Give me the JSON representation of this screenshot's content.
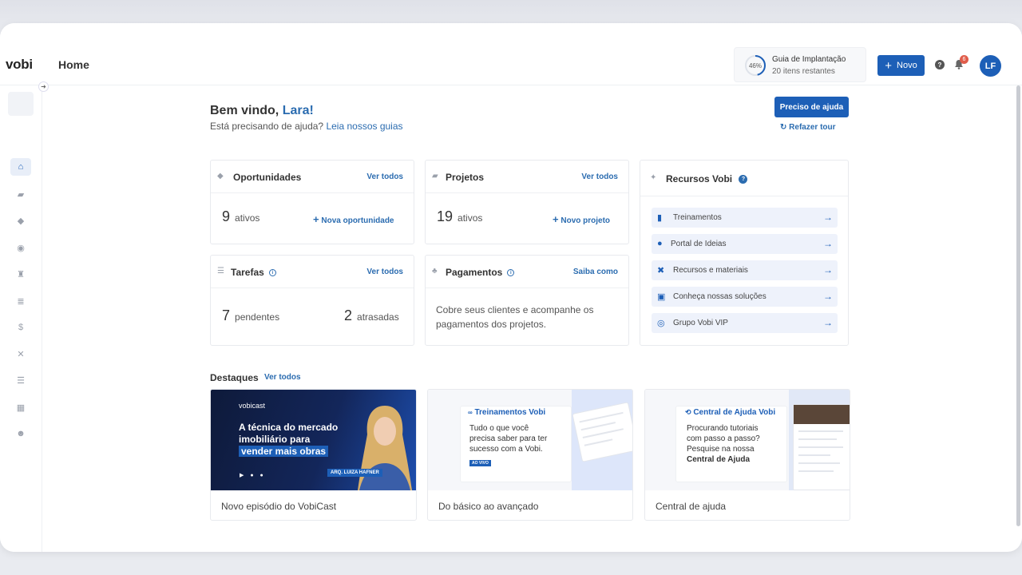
{
  "app": {
    "logo": "vobi",
    "page_title": "Home"
  },
  "guide": {
    "percent": "46%",
    "percent_value": 46,
    "title": "Guia de Implantação",
    "subtitle": "20 itens restantes"
  },
  "header": {
    "new_button": "Novo",
    "notifications_count": "6",
    "avatar_initials": "LF"
  },
  "welcome": {
    "greeting": "Bem vindo,",
    "name": "Lara!",
    "sub_text": "Está precisando de ajuda?",
    "sub_link": "Leia nossos guias",
    "help_button": "Preciso de ajuda",
    "redo_tour": "Refazer tour"
  },
  "cards": {
    "opportunities": {
      "title": "Oportunidades",
      "link": "Ver todos",
      "count": "9",
      "count_label": "ativos",
      "action": "Nova oportunidade"
    },
    "projects": {
      "title": "Projetos",
      "link": "Ver todos",
      "count": "19",
      "count_label": "ativos",
      "action": "Novo projeto"
    },
    "tasks": {
      "title": "Tarefas",
      "link": "Ver todos",
      "pending_count": "7",
      "pending_label": "pendentes",
      "late_count": "2",
      "late_label": "atrasadas"
    },
    "payments": {
      "title": "Pagamentos",
      "link": "Saiba como",
      "body": "Cobre seus clientes e acompanhe os pagamentos dos projetos."
    }
  },
  "resources": {
    "title": "Recursos Vobi",
    "items": [
      {
        "label": "Treinamentos",
        "icon": "book-icon"
      },
      {
        "label": "Portal de Ideias",
        "icon": "lightbulb-icon"
      },
      {
        "label": "Recursos e materiais",
        "icon": "tools-icon"
      },
      {
        "label": "Conheça nossas soluções",
        "icon": "puzzle-icon"
      },
      {
        "label": "Grupo Vobi VIP",
        "icon": "whatsapp-icon"
      }
    ]
  },
  "highlights": {
    "title": "Destaques",
    "link": "Ver todos",
    "items": [
      {
        "caption": "Novo episódio do VobiCast",
        "logo": "vobicast",
        "line1": "A técnica do mercado",
        "line2": "imobiliário para",
        "line3": "vender mais obras",
        "tag": "ARQ. LUIZA HAFNER"
      },
      {
        "caption": "Do básico ao avançado",
        "title": "Treinamentos Vobi",
        "text1": "Tudo o que você",
        "text2": "precisa saber para ter",
        "text3": "sucesso com a Vobi.",
        "badge": "AO VIVO"
      },
      {
        "caption": "Central de ajuda",
        "title": "Central de Ajuda Vobi",
        "text1": "Procurando tutoriais",
        "text2": "com passo a passo?",
        "text3": "Pesquise na nossa",
        "text4": "Central de Ajuda"
      }
    ]
  },
  "colors": {
    "primary": "#1d5fb7",
    "link": "#2b6cb0",
    "badge": "#e05c4a"
  }
}
